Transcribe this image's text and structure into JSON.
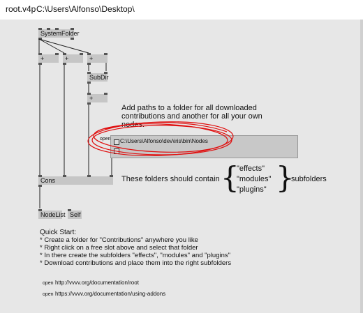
{
  "window": {
    "file_name": "root.v4p",
    "path": "C:\\Users\\Alfonso\\Desktop\\"
  },
  "nodes": {
    "system_folder": "SystemFolder",
    "plus": "+",
    "subdir": "SubDir",
    "cons": "Cons",
    "nodelist": "NodeList",
    "self": "Self"
  },
  "io_box": {
    "open_label": "open",
    "path_value": "C:\\Users\\Alfonso\\dev\\iris\\bin\\Nodes"
  },
  "comments": {
    "add_paths": "Add paths to a folder for all downloaded contributions and another for all your own nodes.",
    "folders_should_contain": "These folders should contain",
    "effects": "\"effects\"",
    "modules": "\"modules\"",
    "plugins": "\"plugins\"",
    "subfolders": "subfolders",
    "quick_start_title": "Quick Start:",
    "steps": [
      "* Create a folder for \"Contributions\" anywhere you like",
      "* Right click on a free slot above and select that folder",
      "* In there create the subfolders \"effects\", \"modules\" and \"plugins\"",
      "* Download contributions and place them into the right subfolders"
    ]
  },
  "links": [
    {
      "open_label": "open",
      "url": "http://vvvv.org/documentation/root"
    },
    {
      "open_label": "open",
      "url": "https://vvvv.org/documentation/using-addons"
    }
  ],
  "colors": {
    "canvas": "#e7e7e7",
    "node": "#c6c6c6",
    "annotation_red": "#e01010"
  }
}
